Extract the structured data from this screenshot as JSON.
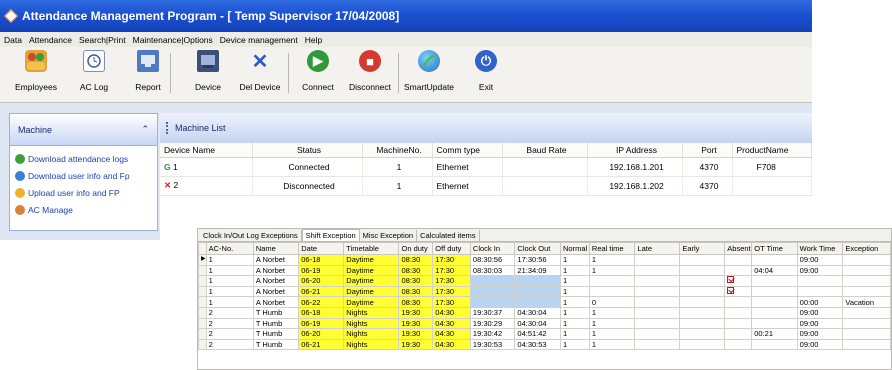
{
  "window": {
    "title": "Attendance Management Program - [ Temp Supervisor 17/04/2008]"
  },
  "menu": [
    "Data",
    "Attendance",
    "Search|Print",
    "Maintenance|Options",
    "Device management",
    "Help"
  ],
  "toolbar": {
    "employees": "Employees",
    "ac_log": "AC Log",
    "report": "Report",
    "device": "Device",
    "del_device": "Del Device",
    "connect": "Connect",
    "disconnect": "Disconnect",
    "smart_update": "SmartUpdate",
    "exit": "Exit"
  },
  "left_panel": {
    "title": "Machine",
    "items": [
      "Download attendance logs",
      "Download user info and Fp",
      "Upload user info and FP",
      "AC Manage"
    ]
  },
  "machine_list": {
    "title": "Machine List",
    "columns": [
      "Device Name",
      "Status",
      "MachineNo.",
      "Comm type",
      "Baud Rate",
      "IP Address",
      "Port",
      "ProductName"
    ],
    "rows": [
      {
        "name": "1",
        "status": "Connected",
        "no": "1",
        "comm": "Ethernet",
        "baud": "",
        "ip": "192.168.1.201",
        "port": "4370",
        "product": "F708"
      },
      {
        "name": "2",
        "status": "Disconnected",
        "no": "1",
        "comm": "Ethernet",
        "baud": "",
        "ip": "192.168.1.202",
        "port": "4370",
        "product": ""
      }
    ]
  },
  "attendance": {
    "tabs": [
      "Clock In/Out Log Exceptions",
      "Shift Exception",
      "Misc Exception",
      "Calculated items"
    ],
    "active_tab": "Shift Exception",
    "columns": [
      "AC-No.",
      "Name",
      "Date",
      "Timetable",
      "On duty",
      "Off duty",
      "Clock In",
      "Clock Out",
      "Normal",
      "Real time",
      "Late",
      "Early",
      "Absent",
      "OT Time",
      "Work Time",
      "Exception"
    ],
    "rows": [
      {
        "ac": "1",
        "name": "A Norbet",
        "date": "06-18",
        "tt": "Daytime",
        "on": "08:30",
        "off": "17:30",
        "in": "08:30:56",
        "out": "17:30:56",
        "normal": "1",
        "real": "1",
        "late": "",
        "early": "",
        "absent": false,
        "ot": "",
        "work": "09:00",
        "exc": ""
      },
      {
        "ac": "1",
        "name": "A Norbet",
        "date": "06-19",
        "tt": "Daytime",
        "on": "08:30",
        "off": "17:30",
        "in": "08:30:03",
        "out": "21:34:09",
        "normal": "1",
        "real": "1",
        "late": "",
        "early": "",
        "absent": false,
        "ot": "04:04",
        "work": "09:00",
        "exc": ""
      },
      {
        "ac": "1",
        "name": "A Norbet",
        "date": "06-20",
        "tt": "Daytime",
        "on": "08:30",
        "off": "17:30",
        "in": "",
        "out": "",
        "normal": "1",
        "real": "",
        "late": "",
        "early": "",
        "absent": true,
        "ot": "",
        "work": "",
        "exc": ""
      },
      {
        "ac": "1",
        "name": "A Norbet",
        "date": "06-21",
        "tt": "Daytime",
        "on": "08:30",
        "off": "17:30",
        "in": "",
        "out": "",
        "normal": "1",
        "real": "",
        "late": "",
        "early": "",
        "absent": true,
        "ot": "",
        "work": "",
        "exc": ""
      },
      {
        "ac": "1",
        "name": "A Norbet",
        "date": "06-22",
        "tt": "Daytime",
        "on": "08:30",
        "off": "17:30",
        "in": "",
        "out": "",
        "normal": "1",
        "real": "0",
        "late": "",
        "early": "",
        "absent": false,
        "ot": "",
        "work": "00:00",
        "exc": "Vacation"
      },
      {
        "ac": "2",
        "name": "T Humb",
        "date": "06-18",
        "tt": "Nights",
        "on": "19:30",
        "off": "04:30",
        "in": "19:30:37",
        "out": "04:30:04",
        "normal": "1",
        "real": "1",
        "late": "",
        "early": "",
        "absent": false,
        "ot": "",
        "work": "09:00",
        "exc": ""
      },
      {
        "ac": "2",
        "name": "T Humb",
        "date": "06-19",
        "tt": "Nights",
        "on": "19:30",
        "off": "04:30",
        "in": "19:30:29",
        "out": "04:30:04",
        "normal": "1",
        "real": "1",
        "late": "",
        "early": "",
        "absent": false,
        "ot": "",
        "work": "09:00",
        "exc": ""
      },
      {
        "ac": "2",
        "name": "T Humb",
        "date": "06-20",
        "tt": "Nights",
        "on": "19:30",
        "off": "04:30",
        "in": "19:30:42",
        "out": "04:51:42",
        "normal": "1",
        "real": "1",
        "late": "",
        "early": "",
        "absent": false,
        "ot": "00:21",
        "work": "09:00",
        "exc": ""
      },
      {
        "ac": "2",
        "name": "T Humb",
        "date": "06-21",
        "tt": "Nights",
        "on": "19:30",
        "off": "04:30",
        "in": "19:30:53",
        "out": "04:30:53",
        "normal": "1",
        "real": "1",
        "late": "",
        "early": "",
        "absent": false,
        "ot": "",
        "work": "09:00",
        "exc": ""
      }
    ]
  },
  "colors": {
    "title_bar": "#1a4fcf",
    "panel": "#dfe6f4",
    "yellow_cell": "#ffff33",
    "missing_cell": "#b9d3f2"
  },
  "icons": [
    "app-icon",
    "employees-icon",
    "ac-log-icon",
    "report-icon",
    "device-icon",
    "del-device-icon",
    "connect-icon",
    "disconnect-icon",
    "smart-update-icon",
    "exit-icon",
    "collapse-icon",
    "device-connected-icon",
    "device-error-icon",
    "absent-check-icon"
  ]
}
